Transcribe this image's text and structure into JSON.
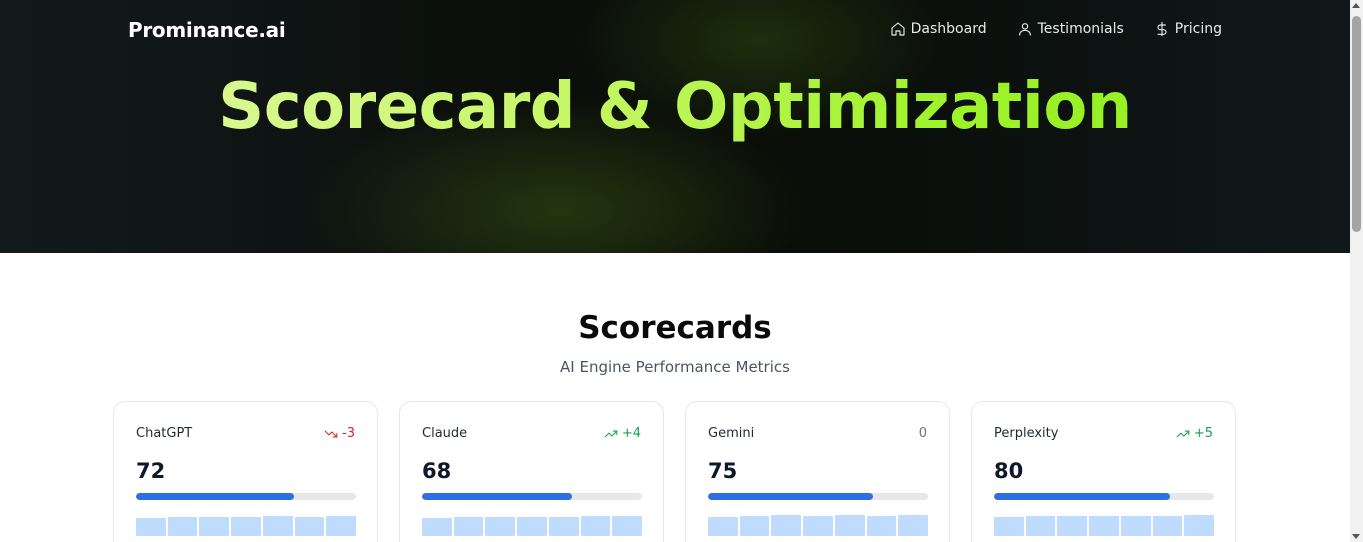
{
  "header": {
    "brand": "Prominance.ai",
    "nav": [
      {
        "label": "Dashboard",
        "icon": "home-icon"
      },
      {
        "label": "Testimonials",
        "icon": "user-icon"
      },
      {
        "label": "Pricing",
        "icon": "dollar-icon"
      }
    ],
    "hero_title": "Scorecard & Optimization"
  },
  "scorecards": {
    "title": "Scorecards",
    "subtitle": "AI Engine Performance Metrics",
    "cards": [
      {
        "name": "ChatGPT",
        "delta": "-3",
        "trend": "down",
        "score": "72",
        "progress": 0.72,
        "history": [
          0.7,
          0.72,
          0.72,
          0.72,
          0.76,
          0.72,
          0.76
        ]
      },
      {
        "name": "Claude",
        "delta": "+4",
        "trend": "up",
        "score": "68",
        "progress": 0.68,
        "history": [
          0.68,
          0.72,
          0.72,
          0.72,
          0.72,
          0.76,
          0.76
        ]
      },
      {
        "name": "Gemini",
        "delta": "0",
        "trend": "flat",
        "score": "75",
        "progress": 0.75,
        "history": [
          0.72,
          0.76,
          0.8,
          0.76,
          0.8,
          0.76,
          0.8
        ]
      },
      {
        "name": "Perplexity",
        "delta": "+5",
        "trend": "up",
        "score": "80",
        "progress": 0.8,
        "history": [
          0.72,
          0.76,
          0.76,
          0.76,
          0.76,
          0.76,
          0.8
        ]
      }
    ]
  },
  "colors": {
    "accent": "#2f6fe4",
    "up": "#16a34a",
    "down": "#dc2626",
    "hero_gradient": [
      "#e3f9a9",
      "#8ef01a"
    ]
  }
}
